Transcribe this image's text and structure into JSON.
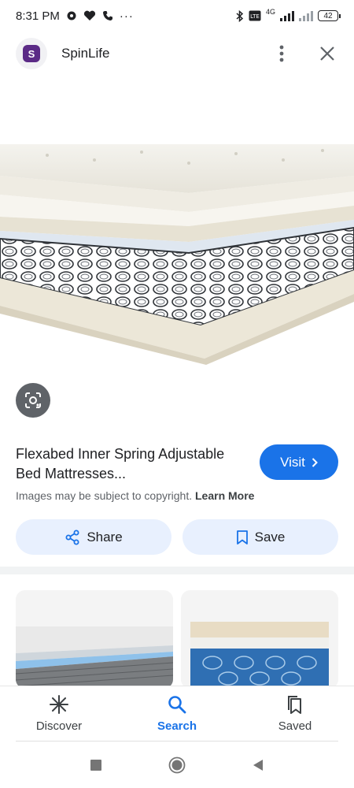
{
  "status_bar": {
    "time": "8:31 PM",
    "battery": "42",
    "network": "4G",
    "more": "···"
  },
  "header": {
    "site_name": "SpinLife",
    "logo_letter": "S"
  },
  "result": {
    "title": "Flexabed Inner Spring Adjustable Bed Mattresses...",
    "visit_label": "Visit",
    "copyright_text": "Images may be subject to copyright.",
    "learn_more": "Learn More",
    "share_label": "Share",
    "save_label": "Save"
  },
  "bottom_nav": [
    {
      "label": "Discover",
      "icon": "asterisk-icon"
    },
    {
      "label": "Search",
      "icon": "search-icon",
      "active": true
    },
    {
      "label": "Saved",
      "icon": "bookmarks-icon"
    }
  ],
  "colors": {
    "accent": "#1a73e8",
    "pill_bg": "#e8f0fe",
    "lens_bg": "#5f6368",
    "logo": "#5b2a86"
  }
}
